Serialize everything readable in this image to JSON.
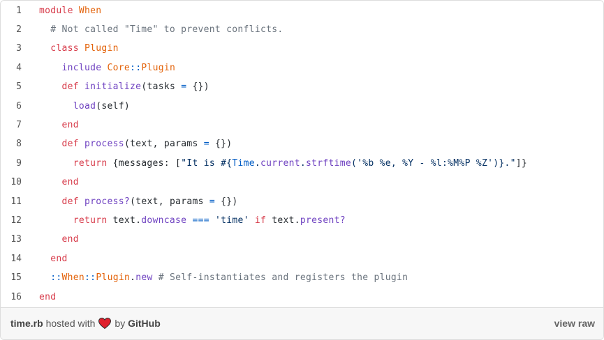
{
  "gist": {
    "lines": [
      [
        {
          "c": "kw",
          "t": "module"
        },
        {
          "c": "pl",
          "t": " "
        },
        {
          "c": "cls",
          "t": "When"
        }
      ],
      [
        {
          "c": "com",
          "t": "  # Not called \"Time\" to prevent conflicts."
        }
      ],
      [
        {
          "c": "pl",
          "t": "  "
        },
        {
          "c": "kw",
          "t": "class"
        },
        {
          "c": "pl",
          "t": " "
        },
        {
          "c": "cls",
          "t": "Plugin"
        }
      ],
      [
        {
          "c": "pl",
          "t": "    "
        },
        {
          "c": "fn",
          "t": "include"
        },
        {
          "c": "pl",
          "t": " "
        },
        {
          "c": "cls",
          "t": "Core"
        },
        {
          "c": "op",
          "t": "::"
        },
        {
          "c": "cls",
          "t": "Plugin"
        }
      ],
      [
        {
          "c": "pl",
          "t": "    "
        },
        {
          "c": "kw",
          "t": "def"
        },
        {
          "c": "pl",
          "t": " "
        },
        {
          "c": "fn",
          "t": "initialize"
        },
        {
          "c": "pl",
          "t": "(tasks "
        },
        {
          "c": "op",
          "t": "="
        },
        {
          "c": "pl",
          "t": " {})"
        }
      ],
      [
        {
          "c": "pl",
          "t": "      "
        },
        {
          "c": "fn",
          "t": "load"
        },
        {
          "c": "pl",
          "t": "(self)"
        }
      ],
      [
        {
          "c": "pl",
          "t": "    "
        },
        {
          "c": "kw",
          "t": "end"
        }
      ],
      [
        {
          "c": "pl",
          "t": "    "
        },
        {
          "c": "kw",
          "t": "def"
        },
        {
          "c": "pl",
          "t": " "
        },
        {
          "c": "fn",
          "t": "process"
        },
        {
          "c": "pl",
          "t": "(text, params "
        },
        {
          "c": "op",
          "t": "="
        },
        {
          "c": "pl",
          "t": " {})"
        }
      ],
      [
        {
          "c": "pl",
          "t": "      "
        },
        {
          "c": "kw",
          "t": "return"
        },
        {
          "c": "pl",
          "t": " {messages: ["
        },
        {
          "c": "str",
          "t": "\"It is #{"
        },
        {
          "c": "op",
          "t": "Time"
        },
        {
          "c": "str",
          "t": "."
        },
        {
          "c": "fn",
          "t": "current"
        },
        {
          "c": "str",
          "t": "."
        },
        {
          "c": "fn",
          "t": "strftime"
        },
        {
          "c": "str",
          "t": "('%b %e, %Y - %l:%M%P %Z')}.\""
        },
        {
          "c": "pl",
          "t": "]}"
        }
      ],
      [
        {
          "c": "pl",
          "t": "    "
        },
        {
          "c": "kw",
          "t": "end"
        }
      ],
      [
        {
          "c": "pl",
          "t": "    "
        },
        {
          "c": "kw",
          "t": "def"
        },
        {
          "c": "pl",
          "t": " "
        },
        {
          "c": "fn",
          "t": "process?"
        },
        {
          "c": "pl",
          "t": "(text, params "
        },
        {
          "c": "op",
          "t": "="
        },
        {
          "c": "pl",
          "t": " {})"
        }
      ],
      [
        {
          "c": "pl",
          "t": "      "
        },
        {
          "c": "kw",
          "t": "return"
        },
        {
          "c": "pl",
          "t": " text."
        },
        {
          "c": "fn",
          "t": "downcase"
        },
        {
          "c": "pl",
          "t": " "
        },
        {
          "c": "op",
          "t": "==="
        },
        {
          "c": "pl",
          "t": " "
        },
        {
          "c": "str",
          "t": "'time'"
        },
        {
          "c": "pl",
          "t": " "
        },
        {
          "c": "kw",
          "t": "if"
        },
        {
          "c": "pl",
          "t": " text."
        },
        {
          "c": "fn",
          "t": "present?"
        }
      ],
      [
        {
          "c": "pl",
          "t": "    "
        },
        {
          "c": "kw",
          "t": "end"
        }
      ],
      [
        {
          "c": "pl",
          "t": "  "
        },
        {
          "c": "kw",
          "t": "end"
        }
      ],
      [
        {
          "c": "pl",
          "t": "  "
        },
        {
          "c": "op",
          "t": "::"
        },
        {
          "c": "cls",
          "t": "When"
        },
        {
          "c": "op",
          "t": "::"
        },
        {
          "c": "cls",
          "t": "Plugin"
        },
        {
          "c": "pl",
          "t": "."
        },
        {
          "c": "fn",
          "t": "new"
        },
        {
          "c": "com",
          "t": " # Self-instantiates and registers the plugin"
        }
      ],
      [
        {
          "c": "kw",
          "t": "end"
        }
      ]
    ],
    "line_numbers": [
      "1",
      "2",
      "3",
      "4",
      "5",
      "6",
      "7",
      "8",
      "9",
      "10",
      "11",
      "12",
      "13",
      "14",
      "15",
      "16"
    ]
  },
  "footer": {
    "filename": "time.rb",
    "hosted_with": "hosted with",
    "by": "by",
    "host": "GitHub",
    "heart_icon": "heart-icon",
    "view_raw": "view raw"
  },
  "colors": {
    "keyword": "#d73a49",
    "constant": "#e36209",
    "function": "#6f42c1",
    "string": "#032f62",
    "comment": "#6a737d",
    "heart": "#e0212e"
  }
}
